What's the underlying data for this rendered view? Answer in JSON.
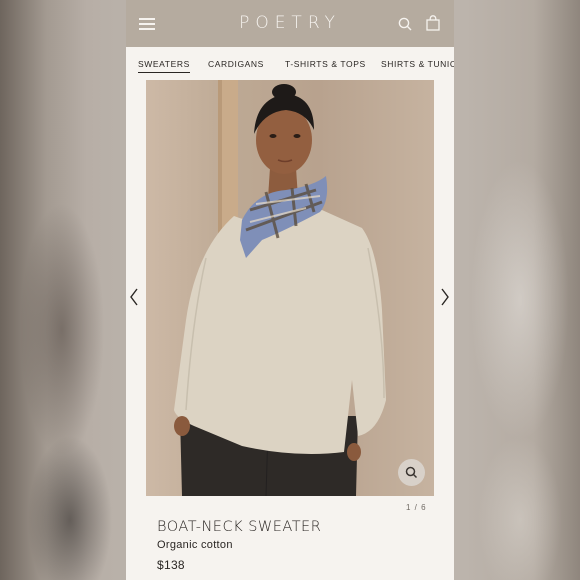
{
  "header": {
    "logo": "POETRY",
    "icons": [
      "menu-icon",
      "search-icon",
      "bag-icon"
    ]
  },
  "tabs": [
    {
      "label": "SWEATERS",
      "active": true
    },
    {
      "label": "CARDIGANS",
      "active": false
    },
    {
      "label": "T-SHIRTS & TOPS",
      "active": false
    },
    {
      "label": "SHIRTS & TUNICS",
      "active": false
    }
  ],
  "gallery": {
    "counter": "1 / 6",
    "icons": [
      "chevron-left-icon",
      "chevron-right-icon",
      "zoom-icon"
    ]
  },
  "product": {
    "name": "BOAT-NECK SWEATER",
    "material": "Organic cotton",
    "price": "$138"
  },
  "colors": {
    "header_bg": "#b5ab9f",
    "page_bg": "#f6f3ef",
    "text": "#2a2623"
  }
}
